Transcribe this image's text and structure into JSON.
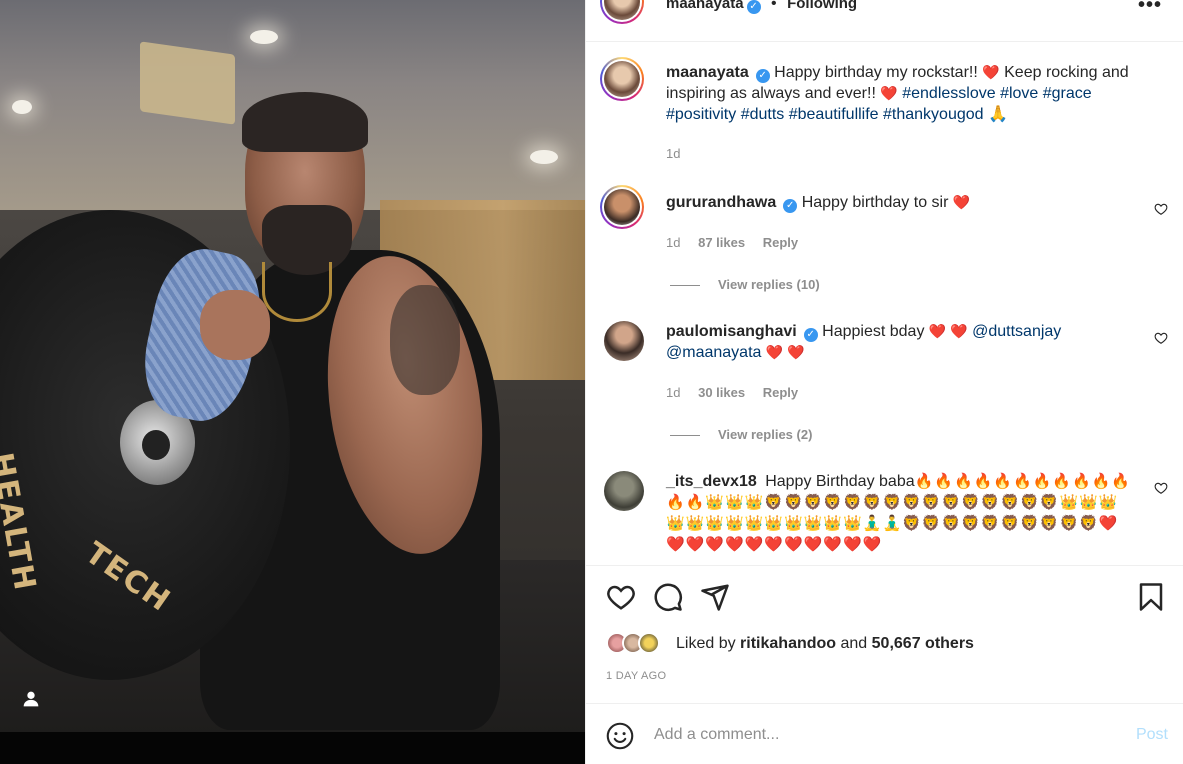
{
  "post": {
    "author": "maanayata",
    "follow_status": "Following",
    "dot": "•",
    "more": "•••"
  },
  "caption": {
    "username": "maanayata",
    "text_1": "Happy birthday my rockstar!! ",
    "text_2": " Keep rocking and inspiring as always and ever!! ",
    "hashtags": "#endlesslove #love #grace #positivity #dutts #beautifullife #thankyougod",
    "emoji_end": "🙏",
    "time": "1d"
  },
  "comments": [
    {
      "username": "gururandhawa",
      "text": "Happy birthday to sir ",
      "emoji": "❤️",
      "time": "1d",
      "likes": "87 likes",
      "reply": "Reply",
      "view_replies": "View replies (10)"
    },
    {
      "username": "paulomisanghavi",
      "text": "Happiest bday ",
      "emoji": "❤️ ❤️",
      "mention_1": "@duttsanjay",
      "mention_2": "@maanayata",
      "emoji_2": "❤️ ❤️",
      "time": "1d",
      "likes": "30 likes",
      "reply": "Reply",
      "view_replies": "View replies (2)"
    },
    {
      "username": "_its_devx18",
      "text": "Happy Birthday baba",
      "emoji_line": "🔥🔥🔥🔥🔥🔥🔥🔥🔥🔥🔥🔥🔥👑👑👑🦁🦁🦁🦁🦁🦁🦁🦁🦁🦁🦁🦁🦁🦁🦁👑👑👑👑👑👑👑👑👑👑👑👑👑🧘‍♂️🧘‍♂️🦁🦁🦁🦁🦁🦁🦁🦁🦁🦁❤️❤️❤️❤️❤️❤️❤️❤️❤️❤️❤️❤️"
    }
  ],
  "likes": {
    "prefix": "Liked by ",
    "user": "ritikahandoo",
    "mid": " and ",
    "count": "50,667 others"
  },
  "time_ago": "1 DAY AGO",
  "add_comment": {
    "placeholder": "Add a comment...",
    "post": "Post"
  },
  "plate_text": [
    "HEALTH",
    "TECH"
  ],
  "colors": {
    "link": "#00376b",
    "meta": "#8e8e8e",
    "post_disabled": "#b2dffc",
    "verified": "#3897f0"
  }
}
